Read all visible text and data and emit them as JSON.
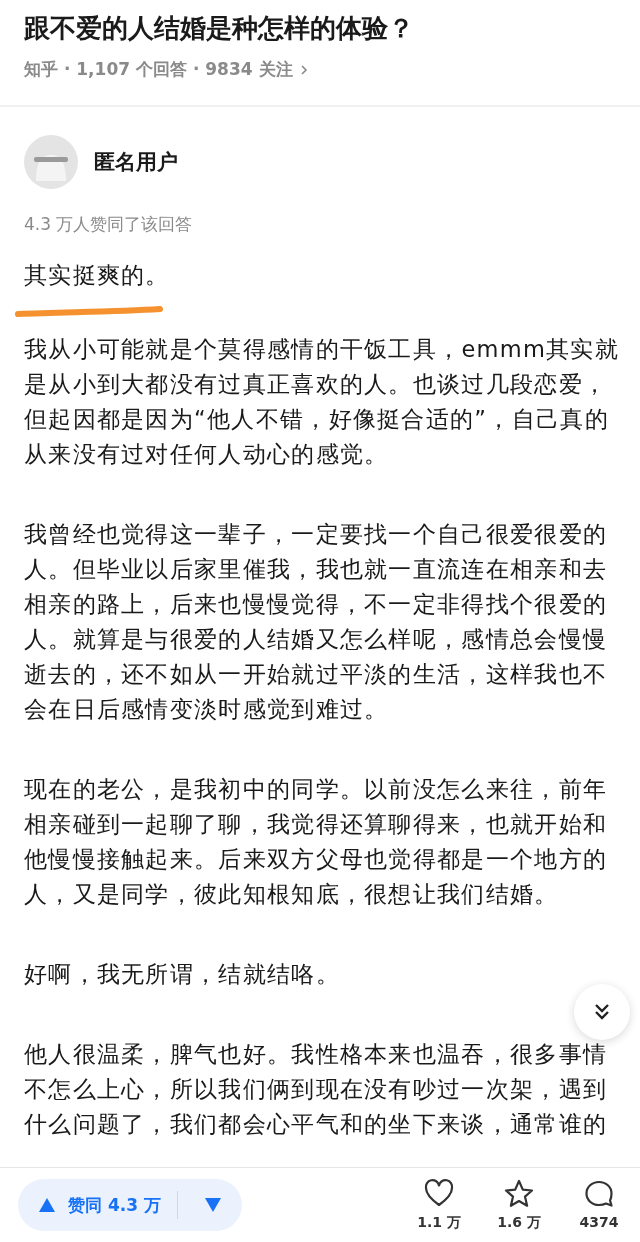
{
  "question": {
    "title": "跟不爱的人结婚是种怎样的体验？",
    "meta": "知乎 · 1,107 个回答 · 9834 关注"
  },
  "answer": {
    "author": "匿名用户",
    "upvote_summary": "4.3 万人赞同了该回答",
    "lead": "其实挺爽的。",
    "paragraphs": [
      {
        "lines": [
          "我从小可能就是个莫得感情的干饭工具，emmm其实就",
          "是从小到大都没有过真正喜欢的人。也谈过几段恋爱，",
          "但起因都是因为“他人不错，好像挺合适的”，自己真的",
          "从来没有过对任何人动心的感觉。"
        ]
      },
      {
        "lines": [
          "我曾经也觉得这一辈子，一定要找一个自己很爱很爱的",
          "人。但毕业以后家里催我，我也就一直流连在相亲和去",
          "相亲的路上，后来也慢慢觉得，不一定非得找个很爱的",
          "人。就算是与很爱的人结婚又怎么样呢，感情总会慢慢",
          "逝去的，还不如从一开始就过平淡的生活，这样我也不",
          "会在日后感情变淡时感觉到难过。"
        ]
      },
      {
        "lines": [
          "现在的老公，是我初中的同学。以前没怎么来往，前年",
          "相亲碰到一起聊了聊，我觉得还算聊得来，也就开始和",
          "他慢慢接触起来。后来双方父母也觉得都是一个地方的",
          "人，又是同学，彼此知根知底，很想让我们结婚。"
        ]
      },
      {
        "lines": [
          "好啊，我无所谓，结就结咯。"
        ]
      },
      {
        "lines": [
          "他人很温柔，脾气也好。我性格本来也温吞，很多事情",
          "不怎么上心，所以我们俩到现在没有吵过一次架，遇到",
          "什么问题了，我们都会心平气和的坐下来谈，通常谁的"
        ]
      }
    ]
  },
  "bottom_bar": {
    "vote_label": "赞同 4.3 万",
    "actions": [
      {
        "kind": "like",
        "count": "1.1 万"
      },
      {
        "kind": "favorite",
        "count": "1.6 万"
      },
      {
        "kind": "comment",
        "count": "4374"
      }
    ]
  }
}
